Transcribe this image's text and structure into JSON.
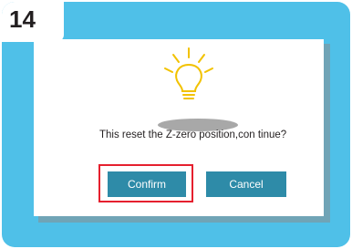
{
  "step": {
    "number": "14"
  },
  "dialog": {
    "icon": "lightbulb-icon",
    "message": "This reset the Z-zero position,con tinue?",
    "confirm_label": "Confirm",
    "cancel_label": "Cancel"
  },
  "colors": {
    "background": "#4fc0e8",
    "button": "#2e8ba8",
    "highlight_border": "#e5202e",
    "bulb": "#f2c200"
  }
}
